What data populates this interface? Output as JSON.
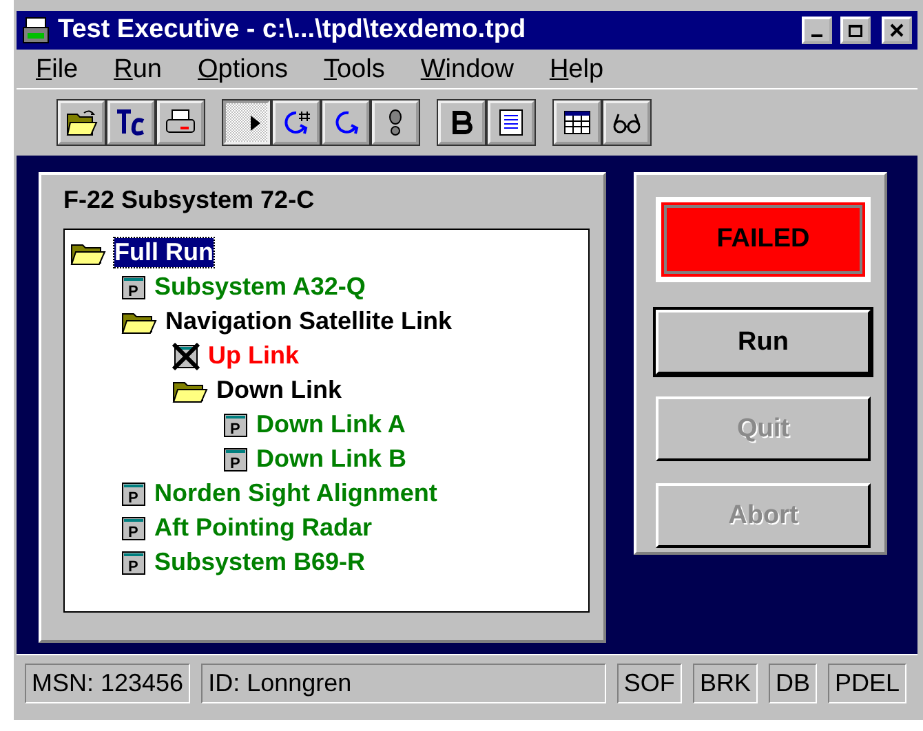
{
  "window": {
    "title": "Test Executive - c:\\...\\tpd\\texdemo.tpd"
  },
  "menu": [
    "File",
    "Run",
    "Options",
    "Tools",
    "Window",
    "Help"
  ],
  "toolbar": [
    [
      {
        "kind": "open",
        "pressed": false
      },
      {
        "kind": "tc",
        "pressed": false
      },
      {
        "kind": "print",
        "pressed": false
      }
    ],
    [
      {
        "kind": "play",
        "pressed": true
      },
      {
        "kind": "loop-count",
        "pressed": false
      },
      {
        "kind": "loop",
        "pressed": false
      },
      {
        "kind": "step",
        "pressed": false
      }
    ],
    [
      {
        "kind": "bold",
        "pressed": false
      },
      {
        "kind": "document",
        "pressed": false
      }
    ],
    [
      {
        "kind": "table",
        "pressed": false
      },
      {
        "kind": "glasses",
        "pressed": false
      }
    ]
  ],
  "panel": {
    "title": "F-22 Subsystem 72-C",
    "tree": [
      {
        "label": "Full Run",
        "kind": "folder",
        "selected": true,
        "children": [
          {
            "label": "Subsystem A32-Q",
            "kind": "program",
            "icon_label": "P",
            "color": "#008000",
            "selected": false
          },
          {
            "label": "Navigation Satellite Link",
            "kind": "folder",
            "color": "#000000",
            "selected": false,
            "children": [
              {
                "label": "Up Link",
                "kind": "failed",
                "color": "#ff0000",
                "selected": false
              },
              {
                "label": "Down Link",
                "kind": "folder",
                "color": "#000000",
                "selected": false,
                "children": [
                  {
                    "label": "Down Link A",
                    "kind": "program",
                    "icon_label": "P",
                    "color": "#008000",
                    "selected": false
                  },
                  {
                    "label": "Down Link B",
                    "kind": "program",
                    "icon_label": "P",
                    "color": "#008000",
                    "selected": false
                  }
                ]
              }
            ]
          },
          {
            "label": "Norden Sight Alignment",
            "kind": "program",
            "icon_label": "P",
            "color": "#008000",
            "selected": false
          },
          {
            "label": "Aft Pointing Radar",
            "kind": "program",
            "icon_label": "P",
            "color": "#008000",
            "selected": false
          },
          {
            "label": "Subsystem B69-R",
            "kind": "program",
            "icon_label": "P",
            "color": "#008000",
            "selected": false
          }
        ]
      }
    ]
  },
  "result": {
    "label": "FAILED",
    "color": "#ff0000"
  },
  "buttons": [
    {
      "label": "Run",
      "disabled": false,
      "default": true
    },
    {
      "label": "Quit",
      "disabled": true,
      "default": false
    },
    {
      "label": "Abort",
      "disabled": true,
      "default": false
    }
  ],
  "status_bar": [
    "MSN: 123456",
    "ID: Lonngren",
    "SOF",
    "BRK",
    "DB",
    "PDEL"
  ]
}
